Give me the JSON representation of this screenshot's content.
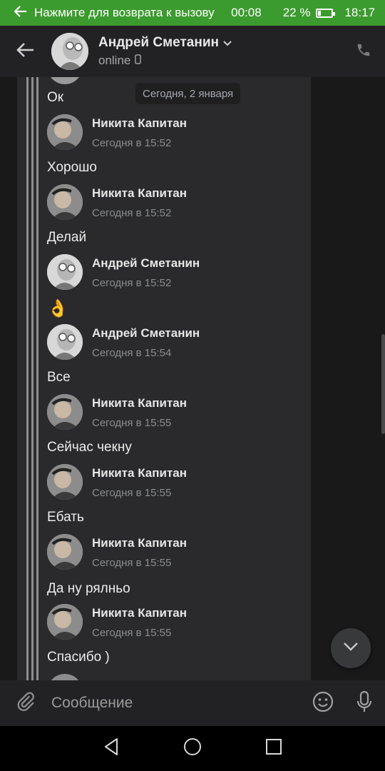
{
  "status_bar": {
    "call_text": "Нажмите для возврата к вызову",
    "call_time": "00:08",
    "battery_percent": "22 %",
    "battery_level": 0.22,
    "clock": "18:17"
  },
  "header": {
    "name": "Андрей Сметанин",
    "status": "online"
  },
  "chat": {
    "date_pill": "Сегодня, 2 января",
    "messages": [
      {
        "text": "Ок"
      },
      {
        "author": "Никита Капитан",
        "time": "Сегодня в 15:52",
        "text": "Хорошо"
      },
      {
        "author": "Никита Капитан",
        "time": "Сегодня в 15:52",
        "text": "Делай"
      },
      {
        "author": "Андрей Сметанин",
        "time": "Сегодня в 15:52",
        "text": "👌"
      },
      {
        "author": "Андрей Сметанин",
        "time": "Сегодня в 15:54",
        "text": "Все"
      },
      {
        "author": "Никита Капитан",
        "time": "Сегодня в 15:55",
        "text": "Сейчас чекну"
      },
      {
        "author": "Никита Капитан",
        "time": "Сегодня в 15:55",
        "text": "Ебать"
      },
      {
        "author": "Никита Капитан",
        "time": "Сегодня в 15:55",
        "text": "Да ну рялньо"
      },
      {
        "author": "Никита Капитан",
        "time": "Сегодня в 15:55",
        "text": "Спасибо )"
      }
    ]
  },
  "composer": {
    "placeholder": "Сообщение"
  },
  "icons": {
    "back": "arrow-left-icon",
    "phone": "phone-icon",
    "attach": "paperclip-icon",
    "emoji": "smile-icon",
    "mic": "microphone-icon",
    "scroll_down": "chevron-down-icon"
  },
  "colors": {
    "call_banner": "#3c9b2e",
    "background": "#19191a",
    "card": "#2a2a2c",
    "header": "#222224"
  }
}
